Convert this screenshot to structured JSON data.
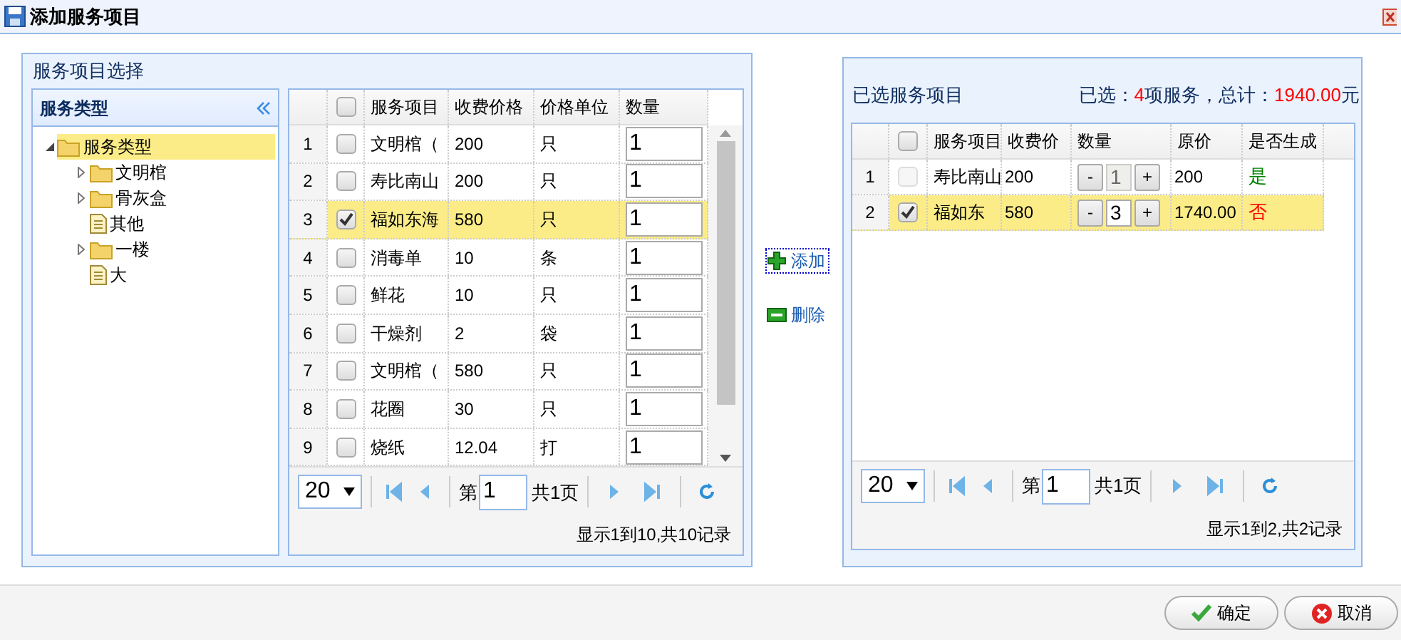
{
  "window": {
    "title": "添加服务项目"
  },
  "picker": {
    "title": "服务项目选择",
    "tree": {
      "title": "服务类型",
      "nodes": [
        {
          "label": "服务类型",
          "kind": "folder",
          "expanded": true,
          "selected": true,
          "children": [
            {
              "label": "文明棺",
              "kind": "folder",
              "expanded": false,
              "selected": false
            },
            {
              "label": "骨灰盒",
              "kind": "folder",
              "expanded": false,
              "selected": false
            },
            {
              "label": "其他",
              "kind": "file",
              "selected": false
            },
            {
              "label": "一楼",
              "kind": "folder",
              "expanded": false,
              "selected": false
            },
            {
              "label": "大",
              "kind": "file",
              "selected": false
            }
          ]
        }
      ]
    },
    "table": {
      "columns": [
        "服务项目",
        "收费价格",
        "价格单位",
        "数量"
      ],
      "header_checked": false,
      "rows": [
        {
          "index": "1",
          "checked": false,
          "selected": false,
          "name": "文明棺（",
          "price": "200",
          "unit": "只",
          "quantity": "1"
        },
        {
          "index": "2",
          "checked": false,
          "selected": false,
          "name": "寿比南山",
          "price": "200",
          "unit": "只",
          "quantity": "1"
        },
        {
          "index": "3",
          "checked": true,
          "selected": true,
          "name": "福如东海",
          "price": "580",
          "unit": "只",
          "quantity": "1"
        },
        {
          "index": "4",
          "checked": false,
          "selected": false,
          "name": "消毒单",
          "price": "10",
          "unit": "条",
          "quantity": "1"
        },
        {
          "index": "5",
          "checked": false,
          "selected": false,
          "name": "鲜花",
          "price": "10",
          "unit": "只",
          "quantity": "1"
        },
        {
          "index": "6",
          "checked": false,
          "selected": false,
          "name": "干燥剂",
          "price": "2",
          "unit": "袋",
          "quantity": "1"
        },
        {
          "index": "7",
          "checked": false,
          "selected": false,
          "name": "文明棺（",
          "price": "580",
          "unit": "只",
          "quantity": "1"
        },
        {
          "index": "8",
          "checked": false,
          "selected": false,
          "name": "花圈",
          "price": "30",
          "unit": "只",
          "quantity": "1"
        },
        {
          "index": "9",
          "checked": false,
          "selected": false,
          "name": "烧纸",
          "price": "12.04",
          "unit": "打",
          "quantity": "1"
        }
      ]
    },
    "pager": {
      "page_size": "20",
      "page_prefix": "第",
      "page": "1",
      "pages": "共1页",
      "info": "显示1到10,共10记录"
    }
  },
  "actions": [
    {
      "label": "添加",
      "kind": "add",
      "focused": true
    },
    {
      "label": "删除",
      "kind": "remove",
      "focused": false
    }
  ],
  "selected": {
    "title": "已选服务项目",
    "summary": {
      "prefix": "已选：",
      "count": "4",
      "middle": "项服务，总计：",
      "total": "1940.00",
      "suffix": "元"
    },
    "table": {
      "columns": [
        "服务项目",
        "收费价",
        "数量",
        "原价",
        "是否生成"
      ],
      "header_checked": false,
      "rows": [
        {
          "index": "1",
          "checked": false,
          "selected": false,
          "disabled": true,
          "name": "寿比南山",
          "price": "200",
          "minus": "-",
          "quantity": "1",
          "plus": "+",
          "original": "200",
          "generated": true,
          "generated_label": "是"
        },
        {
          "index": "2",
          "checked": true,
          "selected": true,
          "disabled": false,
          "name": "福如东",
          "price": "580",
          "minus": "-",
          "quantity": "3",
          "plus": "+",
          "original": "1740.00",
          "generated": false,
          "generated_label": "否"
        }
      ]
    },
    "pager": {
      "page_size": "20",
      "page_prefix": "第",
      "page": "1",
      "pages": "共1页",
      "info": "显示1到2,共2记录"
    }
  },
  "buttons": [
    {
      "label": "确定",
      "kind": "ok"
    },
    {
      "label": "取消",
      "kind": "cancel"
    }
  ]
}
